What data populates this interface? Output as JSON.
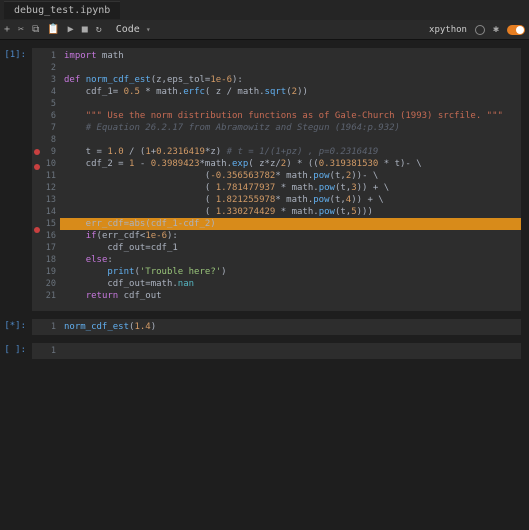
{
  "tab": {
    "title": "debug_test.ipynb"
  },
  "toolbar": {
    "icons": {
      "add": "+",
      "cut": "✂",
      "copy": "⧉",
      "paste": "📋",
      "run": "▶",
      "stop": "■",
      "restart": "↻"
    },
    "celltype": "Code",
    "kernel": "xpython"
  },
  "cells": [
    {
      "prompt": "[1]:",
      "gutter": [
        "1",
        "2",
        "3",
        "4",
        "5",
        "6",
        "7",
        "8",
        "9",
        "10",
        "11",
        "12",
        "13",
        "14",
        "15",
        "16",
        "17",
        "18",
        "19",
        "20",
        "21"
      ],
      "breakpoints": [
        9,
        10,
        15
      ],
      "tokens": [
        [
          [
            "kw",
            "import"
          ],
          [
            "id",
            " math"
          ]
        ],
        [
          [
            "id",
            ""
          ]
        ],
        [
          [
            "kw",
            "def"
          ],
          [
            "id",
            " "
          ],
          [
            "fn",
            "norm_cdf_est"
          ],
          [
            "op",
            "(z,eps_tol="
          ],
          [
            "num",
            "1e-6"
          ],
          [
            "op",
            "):"
          ]
        ],
        [
          [
            "id",
            "    cdf_1= "
          ],
          [
            "num",
            "0.5"
          ],
          [
            "op",
            " * math."
          ],
          [
            "fn",
            "erfc"
          ],
          [
            "op",
            "( z / math."
          ],
          [
            "fn",
            "sqrt"
          ],
          [
            "op",
            "("
          ],
          [
            "num",
            "2"
          ],
          [
            "op",
            "))"
          ]
        ],
        [
          [
            "id",
            ""
          ]
        ],
        [
          [
            "id",
            "    "
          ],
          [
            "doc",
            "\"\"\" Use the norm distribution functions as of Gale-Church (1993) srcfile. \"\"\""
          ]
        ],
        [
          [
            "id",
            "    "
          ],
          [
            "com",
            "# Equation 26.2.17 from Abramowitz and Stegun (1964:p.932)"
          ]
        ],
        [
          [
            "id",
            ""
          ]
        ],
        [
          [
            "id",
            "    t = "
          ],
          [
            "num",
            "1.0"
          ],
          [
            "op",
            " / ("
          ],
          [
            "num",
            "1"
          ],
          [
            "op",
            "+"
          ],
          [
            "num",
            "0.2316419"
          ],
          [
            "op",
            "*z) "
          ],
          [
            "com",
            "# t = 1/(1+pz) , p=0.2316419"
          ]
        ],
        [
          [
            "id",
            "    cdf_2 = "
          ],
          [
            "num",
            "1"
          ],
          [
            "op",
            " - "
          ],
          [
            "num",
            "0.3989423"
          ],
          [
            "op",
            "*math."
          ],
          [
            "fn",
            "exp"
          ],
          [
            "op",
            "( z*z/"
          ],
          [
            "num",
            "2"
          ],
          [
            "op",
            ") * (("
          ],
          [
            "num",
            "0.319381530"
          ],
          [
            "op",
            " * t)- \\"
          ]
        ],
        [
          [
            "id",
            "                          ("
          ],
          [
            "num",
            "-0.356563782"
          ],
          [
            "op",
            "* math."
          ],
          [
            "fn",
            "pow"
          ],
          [
            "op",
            "(t,"
          ],
          [
            "num",
            "2"
          ],
          [
            "op",
            "))- \\"
          ]
        ],
        [
          [
            "id",
            "                          ( "
          ],
          [
            "num",
            "1.781477937"
          ],
          [
            "op",
            " * math."
          ],
          [
            "fn",
            "pow"
          ],
          [
            "op",
            "(t,"
          ],
          [
            "num",
            "3"
          ],
          [
            "op",
            ")) + \\"
          ]
        ],
        [
          [
            "id",
            "                          ( "
          ],
          [
            "num",
            "1.821255978"
          ],
          [
            "op",
            "* math."
          ],
          [
            "fn",
            "pow"
          ],
          [
            "op",
            "(t,"
          ],
          [
            "num",
            "4"
          ],
          [
            "op",
            ")) + \\"
          ]
        ],
        [
          [
            "id",
            "                          ( "
          ],
          [
            "num",
            "1.330274429"
          ],
          [
            "op",
            " * math."
          ],
          [
            "fn",
            "pow"
          ],
          [
            "op",
            "(t,"
          ],
          [
            "num",
            "5"
          ],
          [
            "op",
            ")))"
          ]
        ],
        [
          [
            "id",
            "    err_cdf=abs(cdf_1-cdf_2)"
          ]
        ],
        [
          [
            "id",
            "    "
          ],
          [
            "kw",
            "if"
          ],
          [
            "op",
            "(err_cdf<"
          ],
          [
            "num",
            "1e-6"
          ],
          [
            "op",
            "):"
          ]
        ],
        [
          [
            "id",
            "        cdf_out=cdf_1"
          ]
        ],
        [
          [
            "id",
            "    "
          ],
          [
            "kw",
            "else"
          ],
          [
            "op",
            ":"
          ]
        ],
        [
          [
            "id",
            "        "
          ],
          [
            "fn",
            "print"
          ],
          [
            "op",
            "("
          ],
          [
            "str",
            "'Trouble here?'"
          ],
          [
            "op",
            ")"
          ]
        ],
        [
          [
            "id",
            "        cdf_out=math."
          ],
          [
            "bi",
            "nan"
          ]
        ],
        [
          [
            "id",
            "    "
          ],
          [
            "kw",
            "return"
          ],
          [
            "id",
            " cdf_out"
          ]
        ]
      ]
    },
    {
      "prompt": "[*]:",
      "gutter": [
        "1"
      ],
      "breakpoints": [],
      "tokens": [
        [
          [
            "fn",
            "norm_cdf_est"
          ],
          [
            "op",
            "("
          ],
          [
            "num",
            "1.4"
          ],
          [
            "op",
            ")"
          ]
        ]
      ]
    },
    {
      "prompt": "[ ]:",
      "gutter": [
        "1"
      ],
      "breakpoints": [],
      "tokens": [
        [
          [
            "id",
            ""
          ]
        ]
      ]
    }
  ],
  "highlight": {
    "cell": 0,
    "line": 15
  }
}
